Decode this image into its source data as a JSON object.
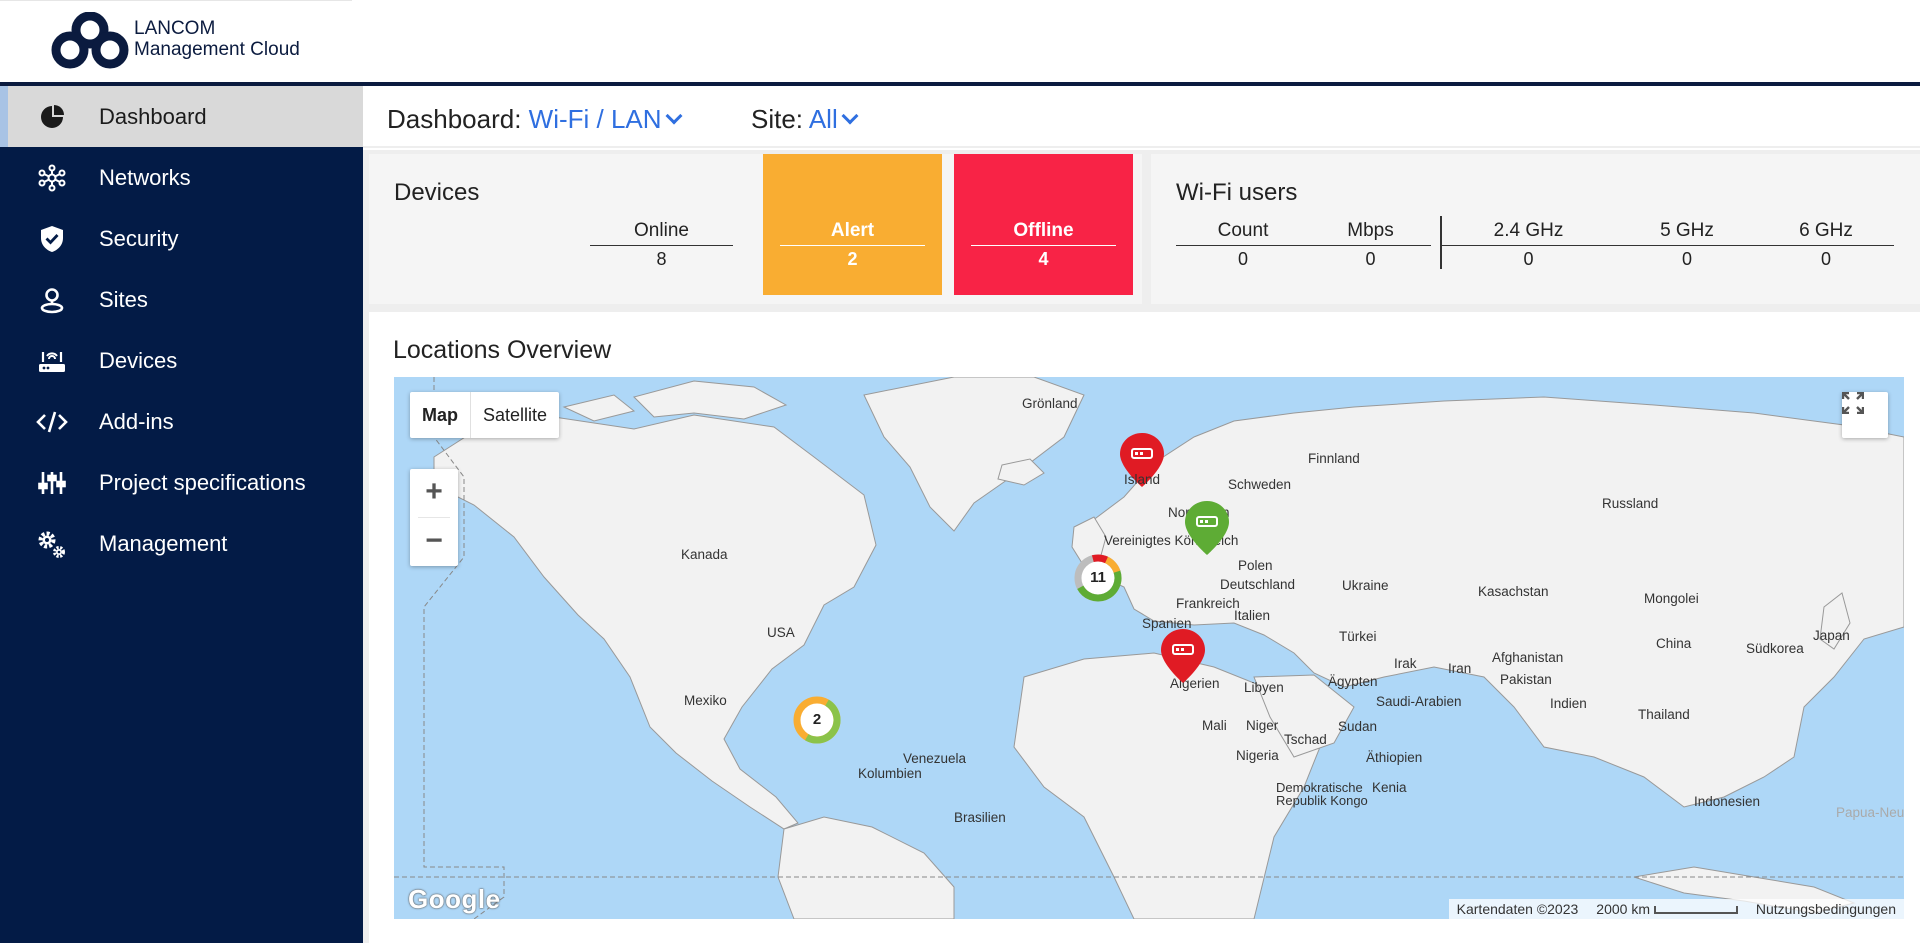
{
  "brand": {
    "line1": "LANCOM",
    "line2": "Management Cloud",
    "color": "#0b1b3f"
  },
  "sidebar": {
    "items": [
      {
        "label": "Dashboard",
        "icon": "dashboard-pie-icon",
        "active": true
      },
      {
        "label": "Networks",
        "icon": "network-nodes-icon"
      },
      {
        "label": "Security",
        "icon": "shield-check-icon"
      },
      {
        "label": "Sites",
        "icon": "location-pin-icon"
      },
      {
        "label": "Devices",
        "icon": "router-icon"
      },
      {
        "label": "Add-ins",
        "icon": "code-icon"
      },
      {
        "label": "Project specifications",
        "icon": "sliders-icon"
      },
      {
        "label": "Management",
        "icon": "gears-icon"
      }
    ]
  },
  "header": {
    "dashboard_label": "Dashboard:",
    "dashboard_value": "Wi-Fi / LAN",
    "site_label": "Site:",
    "site_value": "All"
  },
  "devices": {
    "title": "Devices",
    "online_label": "Online",
    "online_value": "8",
    "alert_label": "Alert",
    "alert_value": "2",
    "offline_label": "Offline",
    "offline_value": "4",
    "alert_color": "#f9ad32",
    "offline_color": "#f82346"
  },
  "wifi_users": {
    "title": "Wi-Fi users",
    "columns": [
      {
        "label": "Count",
        "value": "0"
      },
      {
        "label": "Mbps",
        "value": "0"
      },
      {
        "label": "2.4 GHz",
        "value": "0"
      },
      {
        "label": "5 GHz",
        "value": "0"
      },
      {
        "label": "6 GHz",
        "value": "0"
      }
    ]
  },
  "locations": {
    "title": "Locations Overview",
    "map_type": {
      "map": "Map",
      "satellite": "Satellite"
    },
    "zoom_in": "+",
    "zoom_out": "−",
    "google": "Google",
    "attribution": {
      "data": "Kartendaten ©2023",
      "scale": "2000 km",
      "terms": "Nutzungsbedingungen"
    },
    "labels": {
      "greenland": "Grönland",
      "iceland": "Island",
      "finland": "Finnland",
      "sweden": "Schweden",
      "norway": "Norwegen",
      "russia": "Russland",
      "uk": "Vereinigtes Königreich",
      "poland": "Polen",
      "germany": "Deutschland",
      "ukraine": "Ukraine",
      "france": "Frankreich",
      "italy": "Italien",
      "spain": "Spanien",
      "kazakhstan": "Kasachstan",
      "mongolia": "Mongolei",
      "china": "China",
      "south_korea": "Südkorea",
      "japan": "Japan",
      "turkey": "Türkei",
      "iraq": "Irak",
      "iran": "Iran",
      "afghanistan": "Afghanistan",
      "pakistan": "Pakistan",
      "india": "Indien",
      "thailand": "Thailand",
      "indonesia": "Indonesien",
      "papua": "Papua-Neuguin",
      "canada": "Kanada",
      "usa": "USA",
      "mexico": "Mexiko",
      "venezuela": "Venezuela",
      "colombia": "Kolumbien",
      "brazil": "Brasilien",
      "algeria": "Algerien",
      "libya": "Libyen",
      "egypt": "Ägypten",
      "saudi": "Saudi-Arabien",
      "mali": "Mali",
      "niger": "Niger",
      "chad": "Tschad",
      "sudan": "Sudan",
      "nigeria": "Nigeria",
      "ethiopia": "Äthiopien",
      "drc": "Demokratische Republik Kongo",
      "kenya": "Kenia"
    },
    "clusters": [
      {
        "count": "11"
      },
      {
        "count": "2"
      }
    ],
    "pin_colors": {
      "offline": "#e01b24",
      "online": "#5eac35"
    }
  }
}
